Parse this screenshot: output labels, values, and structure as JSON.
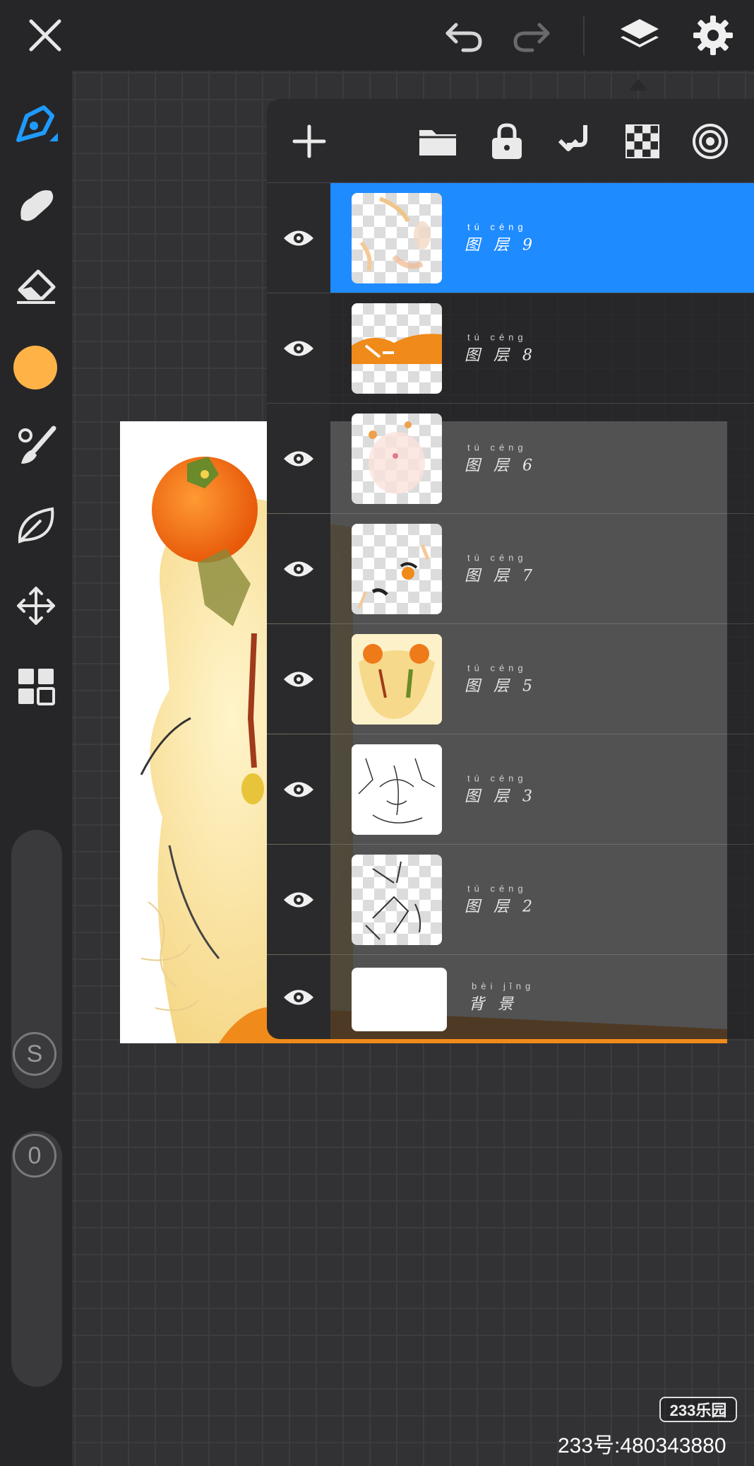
{
  "toolbar": {
    "close_icon": "close-icon",
    "undo_icon": "undo-icon",
    "redo_icon": "redo-icon",
    "layers_icon": "layers-icon",
    "settings_icon": "gear-icon"
  },
  "tools": [
    {
      "name": "pen-tool",
      "icon": "pen-icon",
      "active": true
    },
    {
      "name": "smudge-tool",
      "icon": "smudge-icon"
    },
    {
      "name": "eraser-tool",
      "icon": "eraser-icon"
    },
    {
      "name": "color-picker",
      "icon": "color-swatch",
      "color": "#ffb347"
    },
    {
      "name": "brush-settings",
      "icon": "brush-icon"
    },
    {
      "name": "selection-tool",
      "icon": "leaf-icon"
    },
    {
      "name": "transform-tool",
      "icon": "move-icon"
    },
    {
      "name": "gallery-tool",
      "icon": "grid-icon"
    }
  ],
  "sliders": {
    "size_badge": "S",
    "opacity_badge": "0"
  },
  "layers_panel": {
    "toolbar_icons": [
      "add-icon",
      "folder-icon",
      "lock-icon",
      "merge-down-icon",
      "checker-icon",
      "target-icon"
    ],
    "layers": [
      {
        "pinyin": "tú céng",
        "label": "图 层 9",
        "selected": true
      },
      {
        "pinyin": "tú céng",
        "label": "图 层 8",
        "selected": false
      },
      {
        "pinyin": "tú céng",
        "label": "图 层 6",
        "selected": false
      },
      {
        "pinyin": "tú céng",
        "label": "图 层 7",
        "selected": false
      },
      {
        "pinyin": "tú céng",
        "label": "图 层 5",
        "selected": false
      },
      {
        "pinyin": "tú céng",
        "label": "图 层 3",
        "selected": false
      },
      {
        "pinyin": "tú céng",
        "label": "图 层 2",
        "selected": false
      },
      {
        "pinyin": "bèi jǐng",
        "label": "背 景",
        "selected": false
      }
    ]
  },
  "watermark": {
    "logo": "233乐园",
    "id_text": "233号:480343880"
  },
  "colors": {
    "accent": "#1e8bff",
    "active_tool": "#1e9bff",
    "current_color": "#ffb347"
  }
}
